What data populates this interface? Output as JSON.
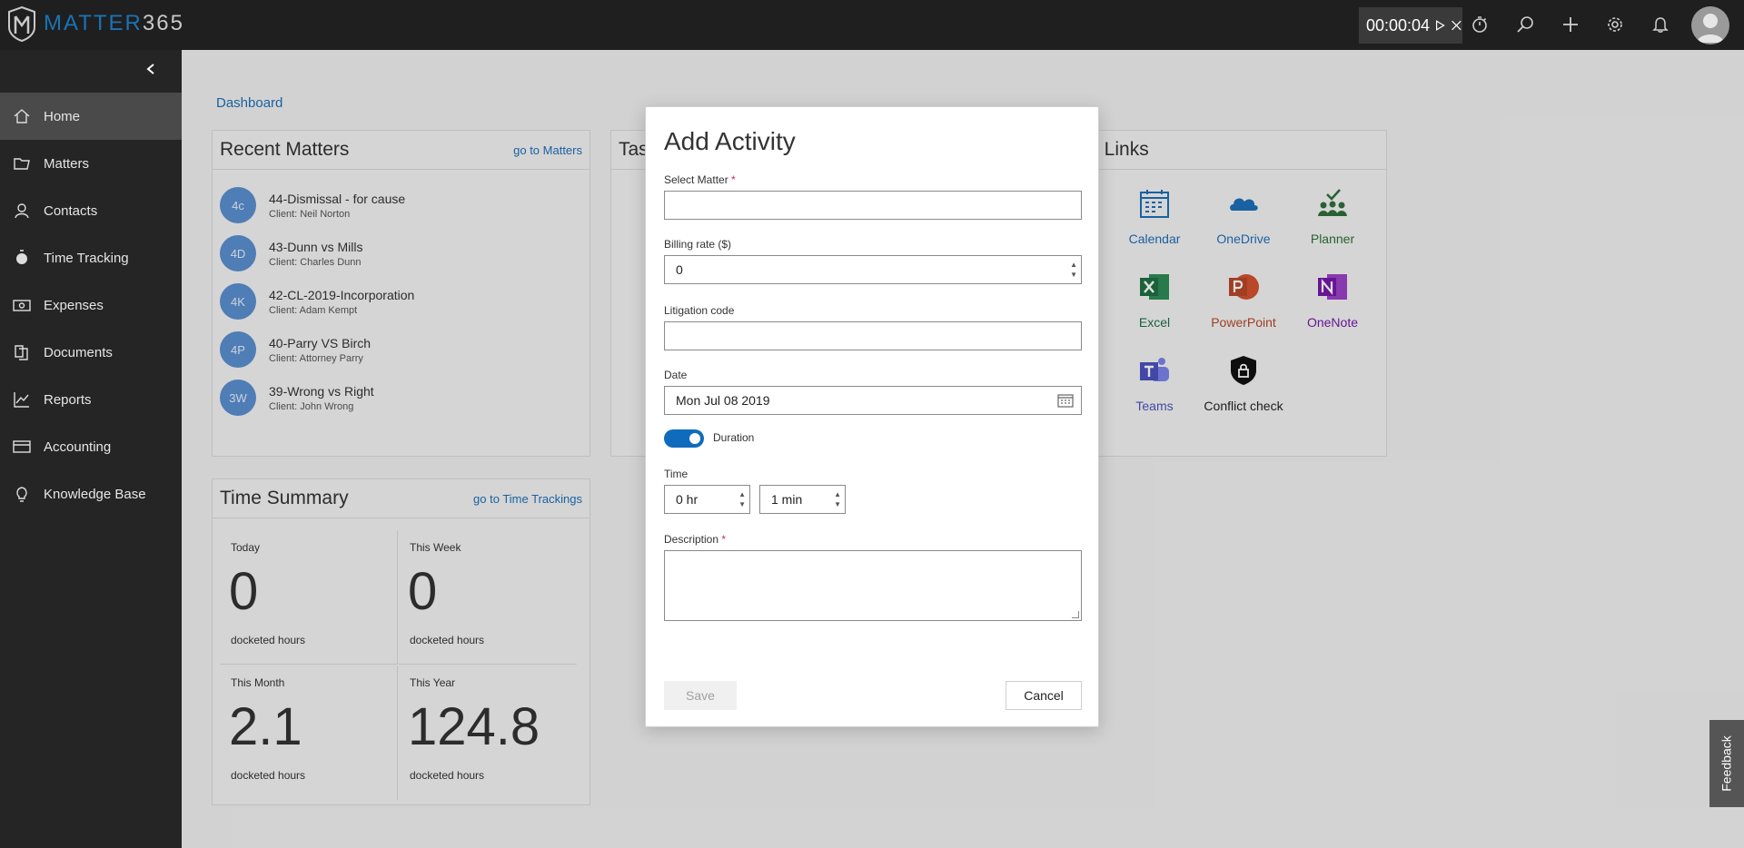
{
  "app": {
    "logo_primary": "MATTER",
    "logo_secondary": "365",
    "timer": "00:00:04"
  },
  "topbar_icons": [
    "play-icon",
    "close-icon",
    "stopwatch-icon",
    "search-icon",
    "plus-icon",
    "gear-icon",
    "bell-icon",
    "user-avatar"
  ],
  "sidebar": {
    "items": [
      {
        "label": "Home",
        "icon": "home-icon",
        "active": true
      },
      {
        "label": "Matters",
        "icon": "folder-icon"
      },
      {
        "label": "Contacts",
        "icon": "person-icon"
      },
      {
        "label": "Time Tracking",
        "icon": "stopwatch-icon"
      },
      {
        "label": "Expenses",
        "icon": "money-icon"
      },
      {
        "label": "Documents",
        "icon": "documents-icon"
      },
      {
        "label": "Reports",
        "icon": "chart-icon"
      },
      {
        "label": "Accounting",
        "icon": "card-icon"
      },
      {
        "label": "Knowledge Base",
        "icon": "lightbulb-icon"
      }
    ]
  },
  "breadcrumb": "Dashboard",
  "recent_matters": {
    "title": "Recent Matters",
    "link": "go to Matters",
    "items": [
      {
        "initials": "4c",
        "name": "44-Dismissal - for cause",
        "client": "Client: Neil Norton"
      },
      {
        "initials": "4D",
        "name": "43-Dunn vs Mills",
        "client": "Client: Charles Dunn"
      },
      {
        "initials": "4K",
        "name": "42-CL-2019-Incorporation",
        "client": "Client: Adam Kempt"
      },
      {
        "initials": "4P",
        "name": "40-Parry VS Birch",
        "client": "Client: Attorney Parry"
      },
      {
        "initials": "3W",
        "name": "39-Wrong vs Right",
        "client": "Client: John Wrong"
      }
    ]
  },
  "tasks_card": {
    "title_fragment": "Tas"
  },
  "time_summary": {
    "title": "Time Summary",
    "link": "go to Time Trackings",
    "cells": [
      {
        "label": "Today",
        "value": "0",
        "unit": "docketed hours"
      },
      {
        "label": "This Week",
        "value": "0",
        "unit": "docketed hours"
      },
      {
        "label": "This Month",
        "value": "2.1",
        "unit": "docketed hours"
      },
      {
        "label": "This Year",
        "value": "124.8",
        "unit": "docketed hours"
      }
    ]
  },
  "quick_links": {
    "title_fragment": "t Links",
    "items": [
      {
        "label": "Calendar",
        "color": "#1d6fb8"
      },
      {
        "label": "OneDrive",
        "color": "#1d6fb8"
      },
      {
        "label": "Planner",
        "color": "#2f6f3a"
      },
      {
        "label": "Excel",
        "color": "#1f6f43"
      },
      {
        "label": "PowerPoint",
        "color": "#b7472a"
      },
      {
        "label": "OneNote",
        "color": "#7719aa"
      },
      {
        "label": "Teams",
        "color": "#4b53bc"
      },
      {
        "label": "Conflict check",
        "color": "#222222"
      }
    ]
  },
  "modal": {
    "title": "Add Activity",
    "select_matter_label": "Select Matter",
    "required_mark": "*",
    "select_matter_value": "",
    "billing_rate_label": "Billing rate ($)",
    "billing_rate_value": "0",
    "litigation_code_label": "Litigation code",
    "litigation_code_value": "",
    "date_label": "Date",
    "date_value": "Mon Jul 08 2019",
    "duration_label": "Duration",
    "duration_on": true,
    "time_label": "Time",
    "hours_value": "0 hr",
    "minutes_value": "1 min",
    "description_label": "Description",
    "description_value": "",
    "save_label": "Save",
    "cancel_label": "Cancel"
  },
  "feedback_label": "Feedback"
}
